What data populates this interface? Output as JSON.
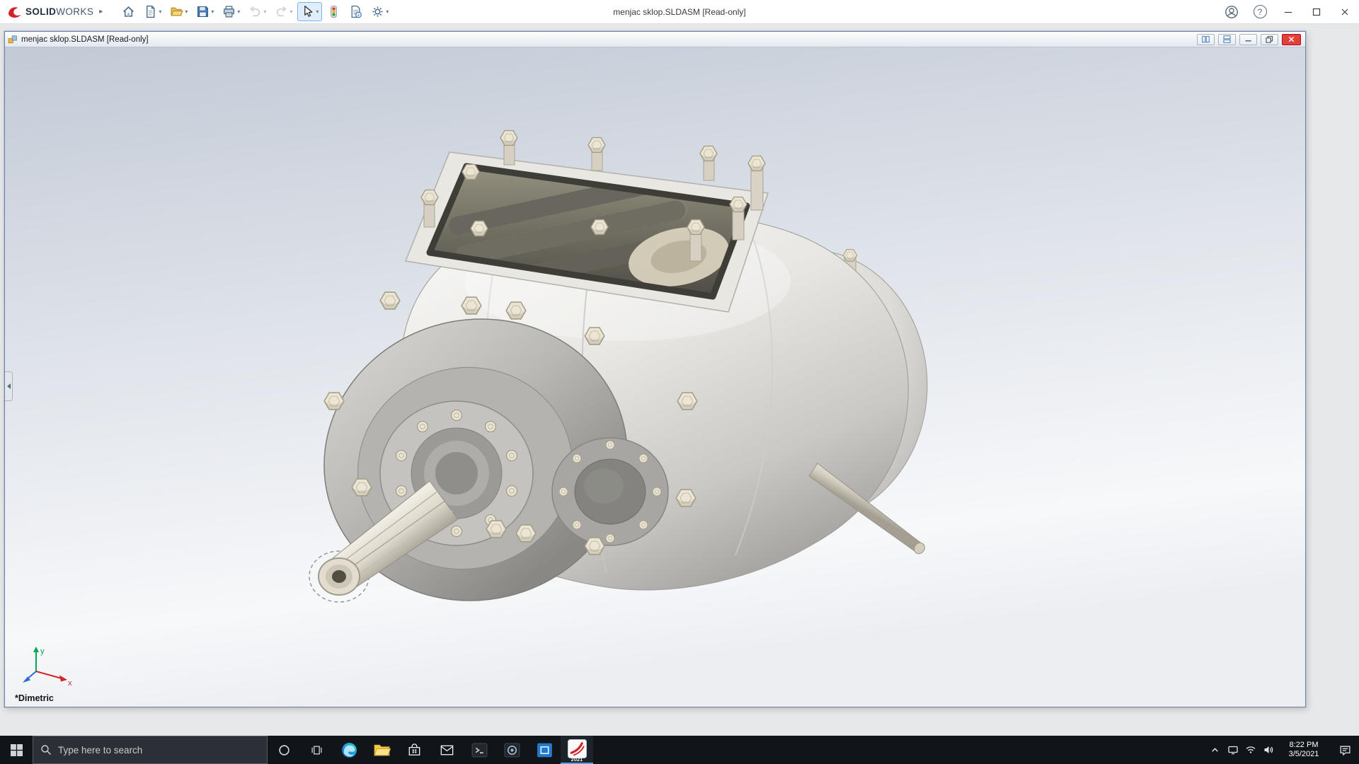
{
  "colors": {
    "titlebar-bg": "#ffffff",
    "taskbar-bg": "#11151a",
    "close-red": "#e04038",
    "brand-red": "#d2232a",
    "accent-blue": "#3a78c2"
  },
  "app_titlebar": {
    "brand_solid": "SOLID",
    "brand_works": "WORKS",
    "document_title": "menjac sklop.SLDASM [Read-only]",
    "expand_glyph": "▸",
    "caret_glyph": "▾",
    "help_glyph": "?",
    "toolbar": [
      {
        "name": "home"
      },
      {
        "name": "new-document"
      },
      {
        "name": "open"
      },
      {
        "name": "save"
      },
      {
        "name": "print"
      },
      {
        "name": "undo"
      },
      {
        "name": "redo"
      },
      {
        "name": "select"
      },
      {
        "name": "rebuild"
      },
      {
        "name": "file-properties"
      },
      {
        "name": "options"
      }
    ]
  },
  "child_window": {
    "title": "menjac sklop.SLDASM [Read-only]",
    "view_orientation_label": "*Dimetric",
    "triad": {
      "x_label": "x",
      "y_label": "y"
    }
  },
  "taskbar": {
    "search": {
      "placeholder": "Type here to search"
    },
    "solidworks_version_badge": "2021",
    "tray": {
      "time": "8:22 PM",
      "date": "3/5/2021"
    }
  }
}
